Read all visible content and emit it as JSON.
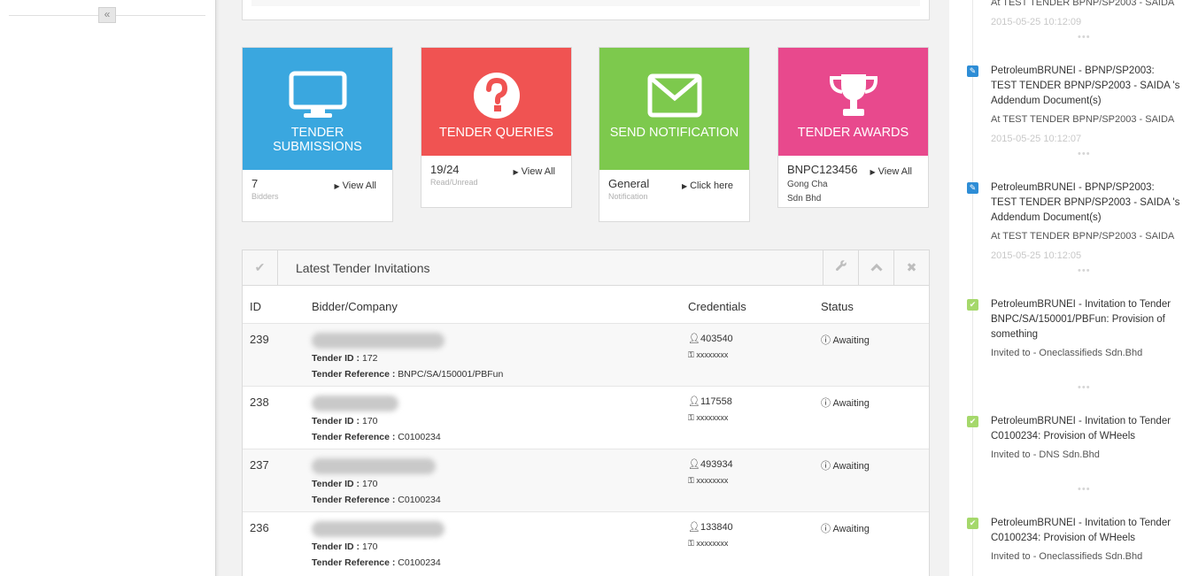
{
  "sidebar": {
    "collapse_label": "«"
  },
  "tiles": [
    {
      "title": "TENDER SUBMISSIONS",
      "value": "7",
      "sub": "Bidders",
      "link": "View All",
      "color": "#3aa7df",
      "icon": "monitor-icon"
    },
    {
      "title": "TENDER QUERIES",
      "value": "19/24",
      "sub": "Read/Unread",
      "link": "View All",
      "color": "#f05352",
      "icon": "question-circle-icon"
    },
    {
      "title": "SEND NOTIFICATION",
      "value": "General",
      "sub": "Notification",
      "link": "Click here",
      "color": "#7dc94d",
      "icon": "envelope-icon"
    },
    {
      "title": "TENDER AWARDS",
      "value": "BNPC123456",
      "sub_line1": "Gong Cha",
      "sub_line2": "Sdn Bhd",
      "link": "View All",
      "color": "#e8498d",
      "icon": "trophy-icon"
    }
  ],
  "widget": {
    "title": "Latest Tender Invitations",
    "columns": {
      "id": "ID",
      "bidder": "Bidder/Company",
      "credentials": "Credentials",
      "status": "Status"
    },
    "tender_id_label": "Tender ID :",
    "tender_ref_label": "Tender Reference :",
    "rows": [
      {
        "id": "239",
        "tender_id": "172",
        "tender_ref": "BNPC/SA/150001/PBFun",
        "user": "403540",
        "pass": "xxxxxxxx",
        "status": "Awaiting"
      },
      {
        "id": "238",
        "tender_id": "170",
        "tender_ref": "C0100234",
        "user": "117558",
        "pass": "xxxxxxxx",
        "status": "Awaiting"
      },
      {
        "id": "237",
        "tender_id": "170",
        "tender_ref": "C0100234",
        "user": "493934",
        "pass": "xxxxxxxx",
        "status": "Awaiting"
      },
      {
        "id": "236",
        "tender_id": "170",
        "tender_ref": "C0100234",
        "user": "133840",
        "pass": "xxxxxxxx",
        "status": "Awaiting"
      }
    ]
  },
  "feed": [
    {
      "sub": "At TEST TENDER BPNP/SP2003 - SAIDA",
      "time": "2015-05-25 10:12:09"
    },
    {
      "type": "edit",
      "title": "PetroleumBRUNEI - BPNP/SP2003: TEST TENDER BPNP/SP2003 - SAIDA 's Addendum Document(s)",
      "sub": "At TEST TENDER BPNP/SP2003 - SAIDA",
      "time": "2015-05-25 10:12:07"
    },
    {
      "type": "edit",
      "title": "PetroleumBRUNEI - BPNP/SP2003: TEST TENDER BPNP/SP2003 - SAIDA 's Addendum Document(s)",
      "sub": "At TEST TENDER BPNP/SP2003 - SAIDA",
      "time": "2015-05-25 10:12:05"
    },
    {
      "type": "ok",
      "title": "PetroleumBRUNEI - Invitation to Tender BNPC/SA/150001/PBFun: Provision of something",
      "sub": "Invited to - Oneclassifieds Sdn.Bhd"
    },
    {
      "type": "ok",
      "title": "PetroleumBRUNEI - Invitation to Tender C0100234: Provision of WHeels",
      "sub": "Invited to - DNS Sdn.Bhd"
    },
    {
      "type": "ok",
      "title": "PetroleumBRUNEI - Invitation to Tender C0100234: Provision of WHeels",
      "sub": "Invited to - Oneclassifieds Sdn.Bhd"
    }
  ],
  "feed_dots": "•••"
}
